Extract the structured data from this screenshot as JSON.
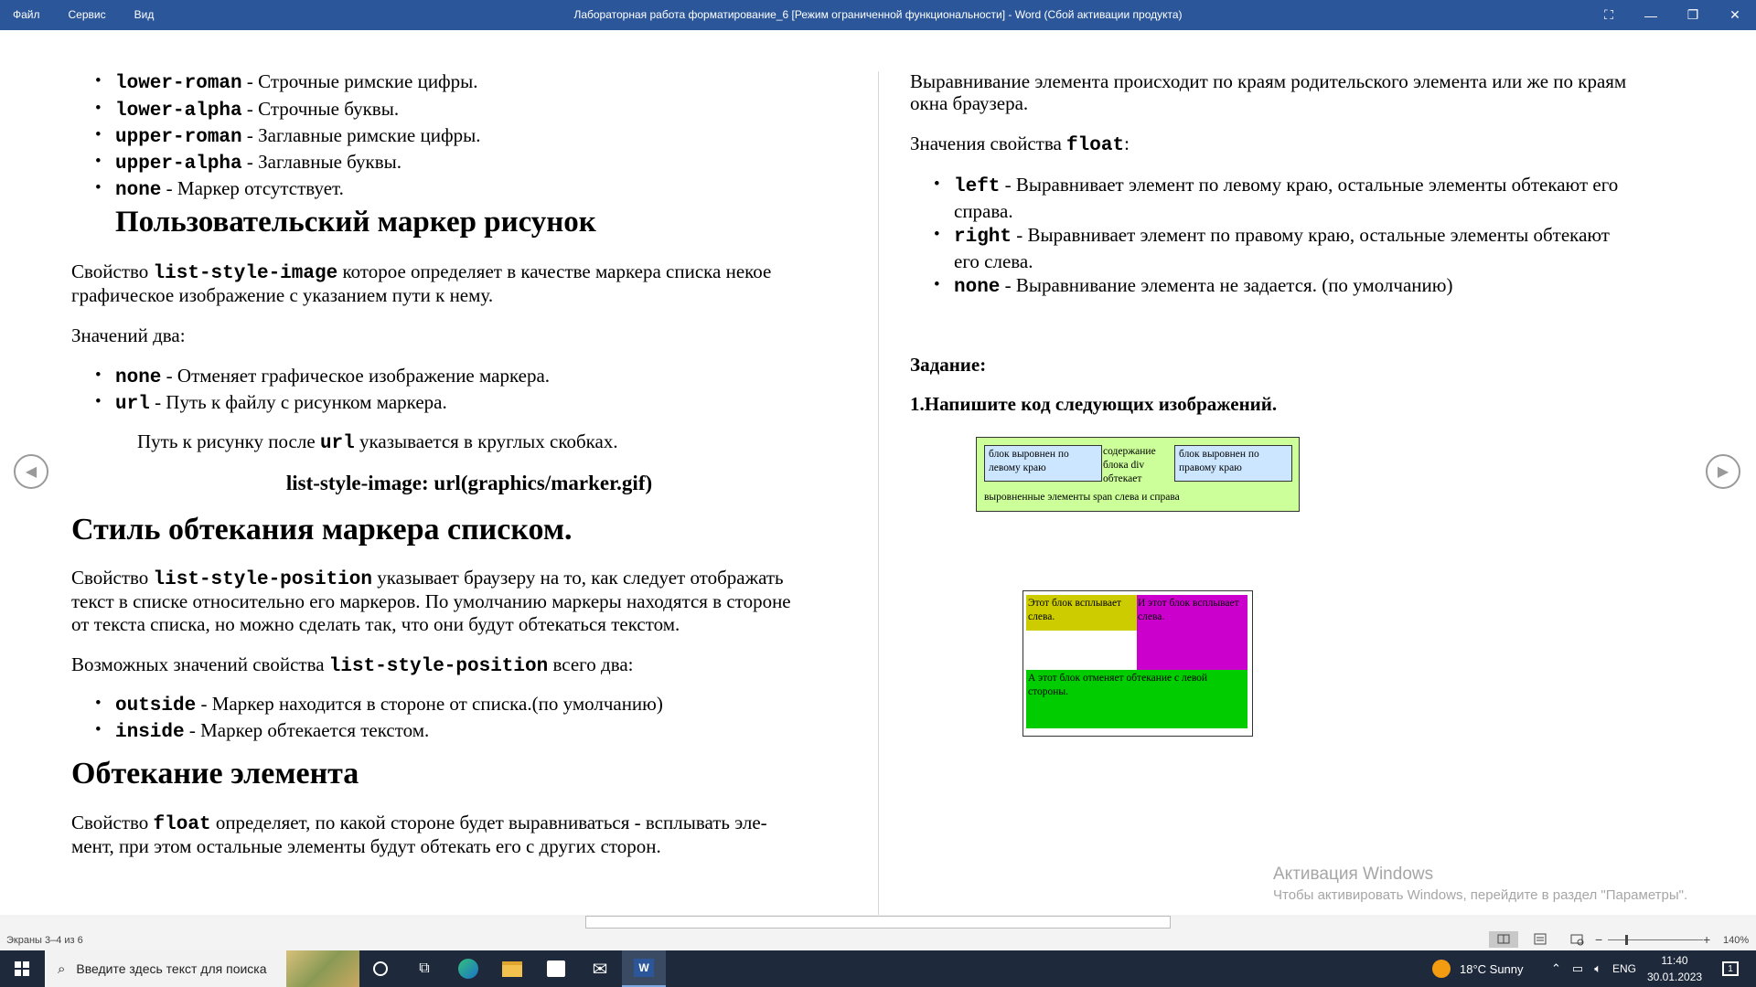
{
  "window": {
    "menu": [
      "Файл",
      "Сервис",
      "Вид"
    ],
    "title": "Лабораторная работа форматирование_6 [Режим ограниченной функциональности] - Word (Сбой активации продукта)",
    "buttons": {
      "fullscreen": "⛶",
      "minimize": "—",
      "restore": "❐",
      "close": "✕"
    }
  },
  "left": {
    "list1": [
      {
        "code": "lower-roman",
        "text": " - Строчные римские цифры."
      },
      {
        "code": "lower-alpha",
        "text": " - Строчные буквы."
      },
      {
        "code": "upper-roman",
        "text": " - Заглавные римские цифры."
      },
      {
        "code": "upper-alpha",
        "text": " - Заглавные буквы."
      },
      {
        "code": "none",
        "text": " - Маркер отсутствует."
      }
    ],
    "h_image": "Пользовательский маркер рисунок",
    "p_image_1": {
      "a": "Свойство ",
      "code": "list-style-image",
      "b": " которое определяет в качестве маркера списка некое"
    },
    "p_image_2": "графическое изображение с указанием пути к нему.",
    "p_two": "Значений два:",
    "list2": [
      {
        "code": "none",
        "text": " - Отменяет графическое изображение маркера."
      },
      {
        "code": "url",
        "text": " - Путь к файлу с рисунком маркера."
      }
    ],
    "p_path": {
      "a": "Путь к рисунку после ",
      "code": "url",
      "b": " указывается в круглых скобках."
    },
    "example": "list-style-image: url(graphics/marker.gif)",
    "h_position": "Стиль обтекания маркера списком.",
    "p_pos_1": {
      "a": "Свойство ",
      "code": "list-style-position",
      "b": " указывает браузеру на то, как следует отображать"
    },
    "p_pos_2": "текст в списке относительно его маркеров. По умолчанию маркеры находятся в стороне",
    "p_pos_3": "от текста списка, но можно сделать так, что они будут обтекаться текстом.",
    "p_pos_vals": {
      "a": "Возможных значений свойства ",
      "code": "list-style-position",
      "b": " всего два:"
    },
    "list3": [
      {
        "code": "outside",
        "text": " - Маркер находится в стороне от списка.(по умолчанию)"
      },
      {
        "code": "inside",
        "text": " - Маркер обтекается текстом."
      }
    ],
    "h_float": "Обтекание элемента",
    "p_float_1": {
      "a": "Свойство ",
      "code": "float",
      "b": " определяет, по какой стороне будет выравниваться - всплывать эле-"
    },
    "p_float_2": "мент, при этом остальные элементы будут обтекать его с других сторон."
  },
  "right": {
    "p1": "Выравнивание элемента происходит по краям родительского элемента или же по краям",
    "p2": "окна браузера.",
    "p_vals": {
      "a": "Значения свойства ",
      "code": "float",
      "b": ":"
    },
    "list": [
      {
        "code": "left",
        "text": " - Выравнивает элемент по левому краю, остальные элементы обтекают его",
        "cont": "справа."
      },
      {
        "code": "right",
        "text": " - Выравнивает элемент по правому краю, остальные элементы обтекают",
        "cont": "его слева."
      },
      {
        "code": "none",
        "text": " - Выравнивание элемента не задается. (по умолчанию)",
        "cont": ""
      }
    ],
    "task": "Задание:",
    "task_item": "1.Напишите код следующих изображений.",
    "fig1": {
      "left_block": "блок выровнен по левому краю",
      "middle": "содержание блока div обтекает",
      "right_block": "блок выровнен по правому краю",
      "bottom": "выровненные элементы span слева и справа",
      "colors": {
        "bg": "#ccff99",
        "block": "#cce6ff"
      }
    },
    "fig2": {
      "yellow": "Этот блок всплывает слева.",
      "magenta": "И этот блок всплывает слева.",
      "green": "А этот блок отменяет обтекание с левой стороны.",
      "colors": {
        "yellow": "#cccc00",
        "magenta": "#cc00cc",
        "green": "#00cc00"
      }
    }
  },
  "watermark": {
    "title": "Активация Windows",
    "sub": "Чтобы активировать Windows, перейдите в раздел \"Параметры\"."
  },
  "status": {
    "pages": "Экраны 3–4 из 6",
    "zoom": "140%",
    "zoom_minus": "−",
    "zoom_plus": "+"
  },
  "taskbar": {
    "search_placeholder": "Введите здесь текст для поиска",
    "weather": "18°C  Sunny",
    "lang": "ENG",
    "time": "11:40",
    "date": "30.01.2023",
    "notif_count": "1"
  }
}
